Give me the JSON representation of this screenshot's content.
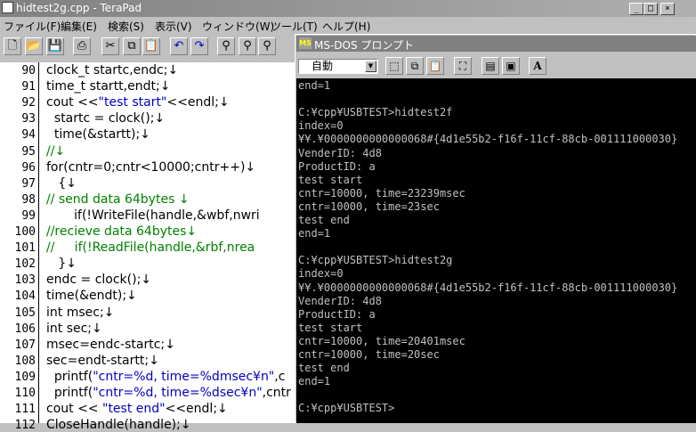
{
  "terapad": {
    "title": "hidtest2g.cpp - TeraPad",
    "menu": [
      "ファイル(F)",
      "編集(E)",
      "検索(S)",
      "表示(V)",
      "ウィンドウ(W)",
      "ツール(T)",
      "ヘルプ(H)"
    ],
    "toolbar_icons": [
      "new-file-icon",
      "open-folder-icon",
      "save-icon",
      "print-icon",
      "cut-icon",
      "copy-icon",
      "paste-icon",
      "undo-icon",
      "redo-icon",
      "find-icon",
      "find-next-icon",
      "find-prev-icon"
    ],
    "window_buttons": [
      "_",
      "□",
      "×"
    ],
    "lines": [
      {
        "n": "90",
        "t": "clock_t startc,endc;↓"
      },
      {
        "n": "91",
        "t": "time_t startt,endt;↓"
      },
      {
        "n": "92",
        "t": "cout <<\"test start\"<<endl;↓"
      },
      {
        "n": "93",
        "t": "  startc = clock();↓"
      },
      {
        "n": "94",
        "t": "  time(&startt);↓"
      },
      {
        "n": "95",
        "t": "//↓"
      },
      {
        "n": "96",
        "t": "for(cntr=0;cntr<10000;cntr++)↓"
      },
      {
        "n": "97",
        "t": "   {↓"
      },
      {
        "n": "98",
        "t": "// send data 64bytes ↓"
      },
      {
        "n": "99",
        "t": "       if(!WriteFile(handle,&wbf,nwri"
      },
      {
        "n": "100",
        "t": "//recieve data 64bytes↓"
      },
      {
        "n": "101",
        "t": "//     if(!ReadFile(handle,&rbf,nrea"
      },
      {
        "n": "102",
        "t": "   }↓"
      },
      {
        "n": "103",
        "t": "endc = clock();↓"
      },
      {
        "n": "104",
        "t": "time(&endt);↓"
      },
      {
        "n": "105",
        "t": "int msec;↓"
      },
      {
        "n": "106",
        "t": "int sec;↓"
      },
      {
        "n": "107",
        "t": "msec=endc-startc;↓"
      },
      {
        "n": "108",
        "t": "sec=endt-startt;↓"
      },
      {
        "n": "109",
        "t": "  printf(\"cntr=%d, time=%dmsec¥n\",c"
      },
      {
        "n": "110",
        "t": "  printf(\"cntr=%d, time=%dsec¥n\",cntr"
      },
      {
        "n": "111",
        "t": "cout << \"test end\"<<endl;↓"
      },
      {
        "n": "112",
        "t": "CloseHandle(handle);↓"
      }
    ]
  },
  "dos": {
    "title": "MS-DOS プロンプト",
    "font_select": "自動",
    "console_lines": [
      "end=1",
      "",
      "C:¥cpp¥USBTEST>hidtest2f",
      "index=0",
      "¥¥.¥0000000000000068#{4d1e55b2-f16f-11cf-88cb-001111000030}",
      "VenderID: 4d8",
      "ProductID: a",
      "test start",
      "cntr=10000, time=23239msec",
      "cntr=10000, time=23sec",
      "test end",
      "end=1",
      "",
      "C:¥cpp¥USBTEST>hidtest2g",
      "index=0",
      "¥¥.¥0000000000000068#{4d1e55b2-f16f-11cf-88cb-001111000030}",
      "VenderID: 4d8",
      "ProductID: a",
      "test start",
      "cntr=10000, time=20401msec",
      "cntr=10000, time=20sec",
      "test end",
      "end=1",
      "",
      "C:¥cpp¥USBTEST>"
    ]
  }
}
